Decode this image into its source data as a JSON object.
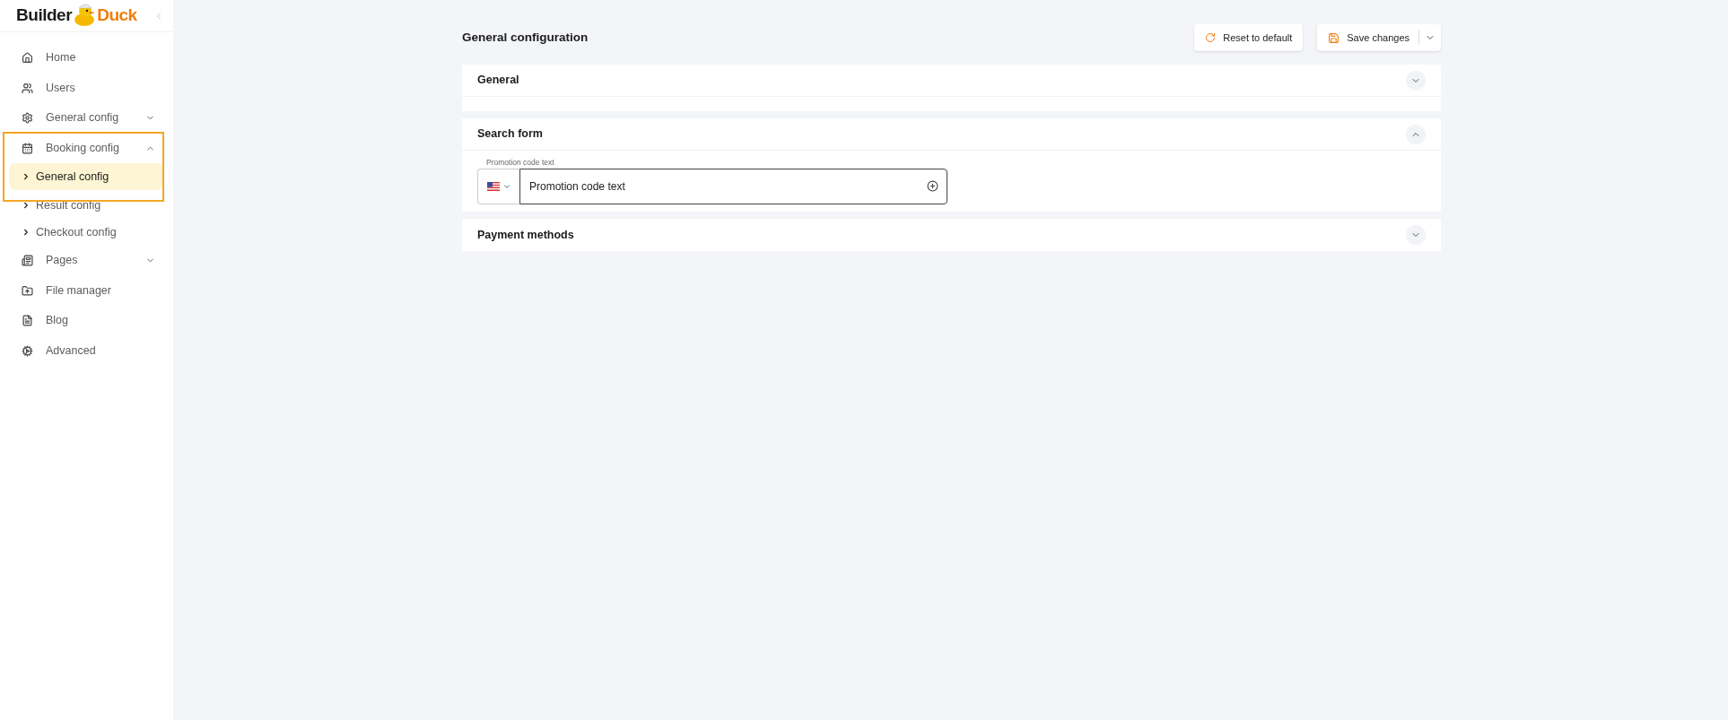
{
  "logo": {
    "part_1": "Builder",
    "part_2": "Duck"
  },
  "sidebar": {
    "items": [
      {
        "label": "Home"
      },
      {
        "label": "Users"
      },
      {
        "label": "General config",
        "expanded": false
      },
      {
        "label": "Booking config",
        "expanded": true,
        "children": [
          {
            "label": "General config",
            "selected": true
          },
          {
            "label": "Result config",
            "selected": false
          },
          {
            "label": "Checkout config",
            "selected": false
          }
        ]
      },
      {
        "label": "Pages",
        "expanded": false
      },
      {
        "label": "File manager"
      },
      {
        "label": "Blog"
      },
      {
        "label": "Advanced"
      }
    ]
  },
  "page": {
    "title": "General configuration",
    "buttons": [
      {
        "label": "Reset to default",
        "kind": "reset"
      },
      {
        "label": "Save changes",
        "kind": "save"
      }
    ]
  },
  "sections": [
    {
      "title": "General",
      "expanded": false
    },
    {
      "title": "Search form",
      "expanded": true,
      "field": {
        "label": "Promotion code text",
        "value": "Promotion code text"
      }
    },
    {
      "title": "Payment methods",
      "expanded": false
    }
  ]
}
